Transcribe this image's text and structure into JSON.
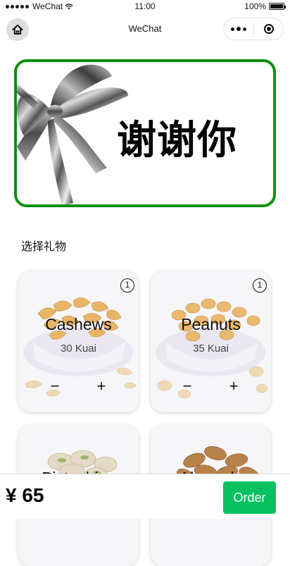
{
  "status_bar": {
    "carrier": "WeChat",
    "time": "11:00",
    "battery": "100%",
    "battery_level": 1.0
  },
  "nav": {
    "title": "WeChat",
    "home_icon": "home-icon",
    "more_icon": "more-dots-icon",
    "close_icon": "target-icon"
  },
  "banner": {
    "text": "谢谢你",
    "border_color": "#109010"
  },
  "section": {
    "title": "选择礼物"
  },
  "products": [
    {
      "name": "Cashews",
      "price": "30 Kuai",
      "quantity": "1",
      "minus": "−",
      "plus": "+"
    },
    {
      "name": "Peanuts",
      "price": "35 Kuai",
      "quantity": "1",
      "minus": "−",
      "plus": "+"
    },
    {
      "name": "Pistachios",
      "price": "",
      "quantity": "",
      "minus": "",
      "plus": ""
    },
    {
      "name": "Almonds",
      "price": "",
      "quantity": "",
      "minus": "",
      "plus": ""
    }
  ],
  "footer": {
    "total": "¥ 65",
    "order_label": "Order",
    "order_color": "#07c160"
  }
}
